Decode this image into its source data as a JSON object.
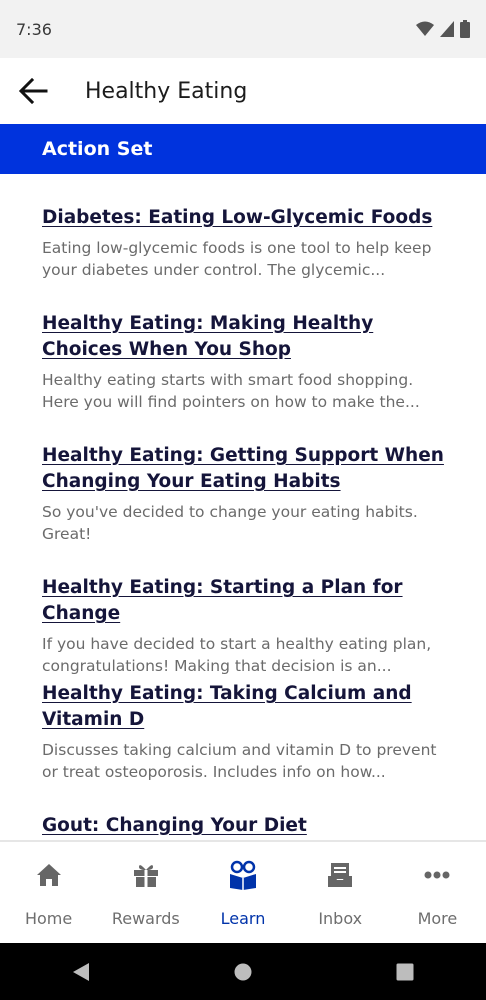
{
  "status_bar": {
    "time": "7:36"
  },
  "app_bar": {
    "title": "Healthy Eating"
  },
  "section": {
    "title": "Action Set"
  },
  "articles": [
    {
      "title": "Diabetes: Eating Low-Glycemic Foods",
      "description": "Eating low-glycemic foods is one tool to help keep your diabetes under control. The glycemic..."
    },
    {
      "title": "Healthy Eating: Making Healthy Choices When You Shop",
      "description": "Healthy eating starts with smart food shopping. Here you will find pointers on how to make the..."
    },
    {
      "title": "Healthy Eating: Getting Support When Changing Your Eating Habits",
      "description": "So you've decided to change your eating habits. Great!"
    },
    {
      "title": "Healthy Eating: Starting a Plan for Change",
      "description": "If you have decided to start a healthy eating plan, congratulations! Making that decision is an..."
    },
    {
      "title": "Healthy Eating: Taking Calcium and Vitamin D",
      "description": "Discusses taking calcium and vitamin D to prevent or treat osteoporosis. Includes info on how..."
    },
    {
      "title": "Gout: Changing Your Diet",
      "description": ""
    }
  ],
  "bottom_nav": {
    "items": [
      {
        "label": "Home",
        "icon": "home-icon"
      },
      {
        "label": "Rewards",
        "icon": "gift-icon"
      },
      {
        "label": "Learn",
        "icon": "learn-icon",
        "active": true
      },
      {
        "label": "Inbox",
        "icon": "inbox-icon"
      },
      {
        "label": "More",
        "icon": "more-icon"
      }
    ]
  },
  "colors": {
    "accent": "#0033dd",
    "active_nav": "#0033aa",
    "title_text": "#15153a"
  }
}
